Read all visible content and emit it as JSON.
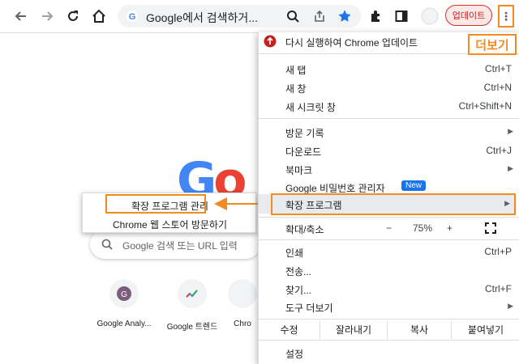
{
  "toolbar": {
    "omnibox_text": "Google에서 검색하거...",
    "update_label": "업데이트"
  },
  "page": {
    "logo_text": "Go",
    "search_placeholder": "Google 검색 또는 URL 입력",
    "shortcuts": [
      {
        "label": "Google Analy...",
        "letter": "G"
      },
      {
        "label": "Google 트렌드"
      },
      {
        "label": "Chro"
      }
    ]
  },
  "annotation": {
    "more_label": "더보기"
  },
  "submenu": {
    "manage_label": "확장 프로그램 관리",
    "store_label": "Chrome 웹 스토어 방문하기"
  },
  "menu": {
    "relaunch": "다시 실행하여 Chrome 업데이트",
    "new_tab": "새 탭",
    "new_tab_shortcut": "Ctrl+T",
    "new_window": "새 창",
    "new_window_shortcut": "Ctrl+N",
    "incognito": "새 시크릿 창",
    "incognito_shortcut": "Ctrl+Shift+N",
    "history": "방문 기록",
    "downloads": "다운로드",
    "downloads_shortcut": "Ctrl+J",
    "bookmarks": "북마크",
    "passwords": "Google 비밀번호 관리자",
    "new_badge": "New",
    "extensions": "확장 프로그램",
    "zoom_label": "확대/축소",
    "zoom_minus": "−",
    "zoom_value": "75%",
    "zoom_plus": "+",
    "print": "인쇄",
    "print_shortcut": "Ctrl+P",
    "cast": "전송...",
    "find": "찾기...",
    "find_shortcut": "Ctrl+F",
    "more_tools": "도구 더보기",
    "edit": "수정",
    "cut": "잘라내기",
    "copy": "복사",
    "paste": "붙여넣기",
    "settings": "설정"
  },
  "colors": {
    "accent_orange": "#f28b20",
    "chrome_blue": "#1a73e8"
  }
}
